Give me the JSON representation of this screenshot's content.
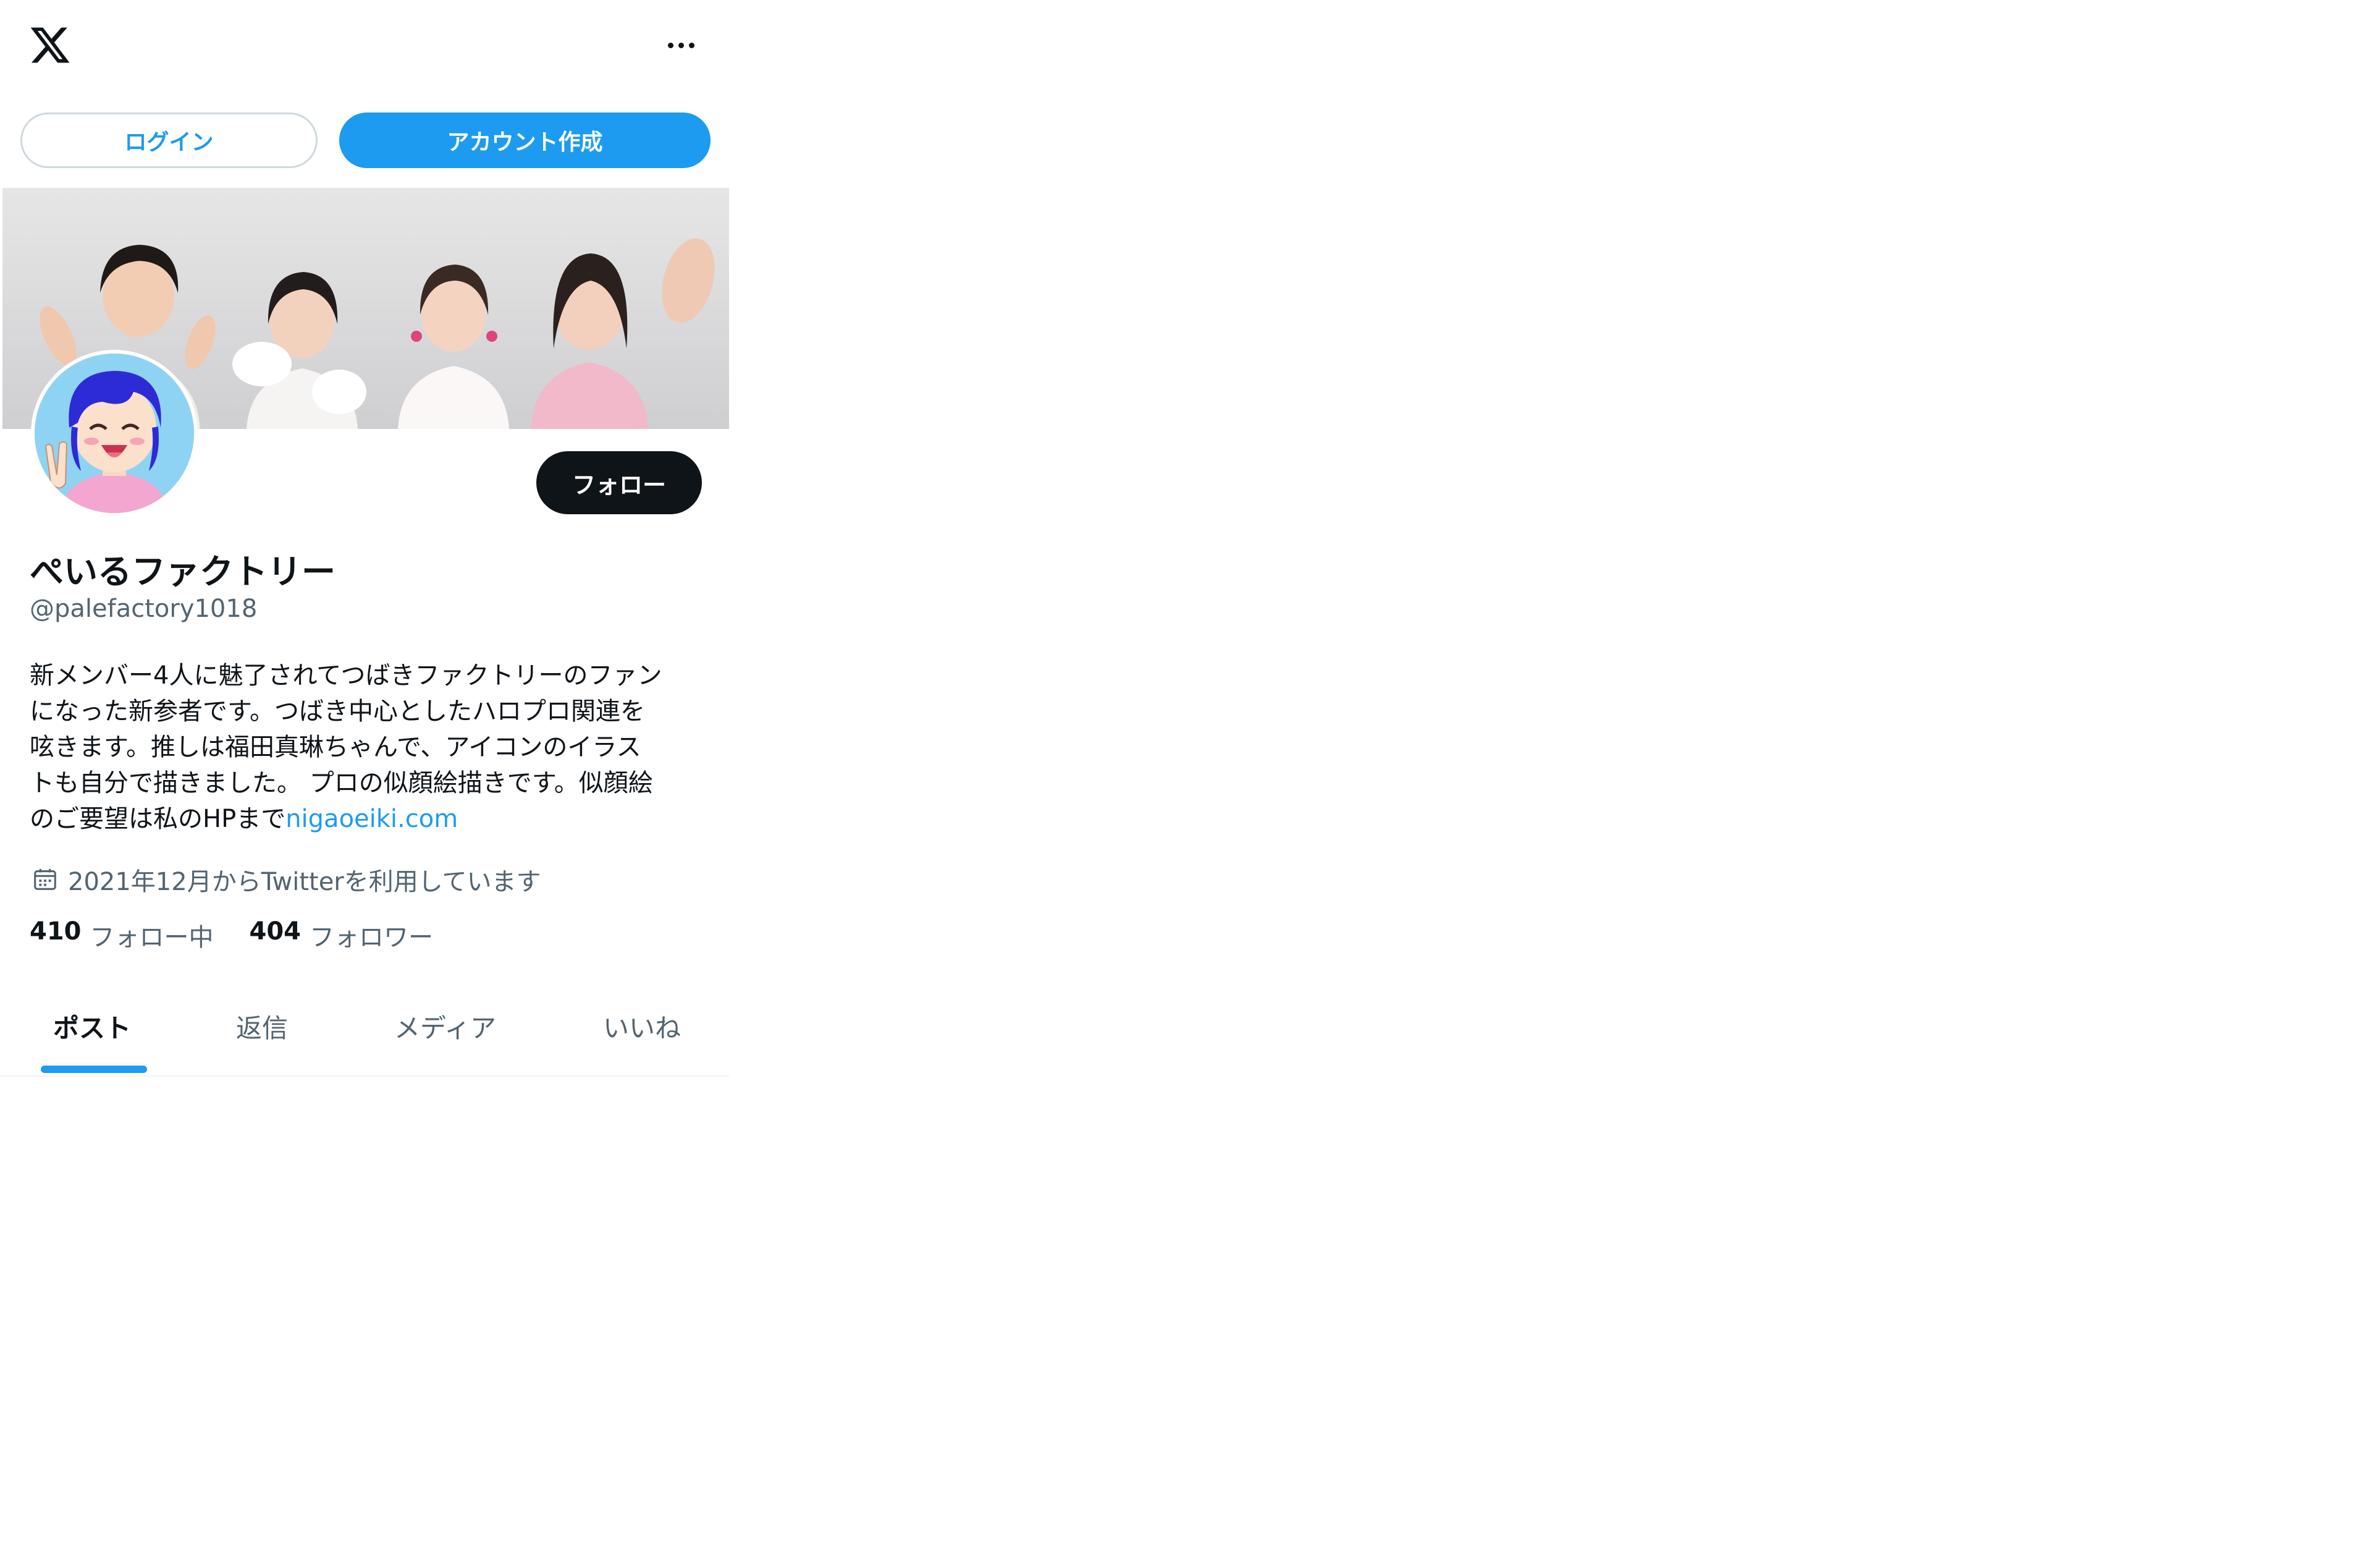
{
  "top_bar": {
    "logo_icon": "x-logo-icon",
    "more_icon": "more-horizontal-icon"
  },
  "auth": {
    "login_label": "ログイン",
    "signup_label": "アカウント作成"
  },
  "profile": {
    "follow_label": "フォロー",
    "display_name": "ぺいるファクトリー",
    "handle": "@palefactory1018",
    "bio_lines": [
      "新メンバー4人に魅了されてつばきファクトリーのファン",
      "になった新参者です。つばき中心としたハロプロ関連を",
      "呟きます。推しは福田真琳ちゃんで、アイコンのイラス",
      "トも自分で描きました。 プロの似顔絵描きです。似顔絵",
      "のご要望は私のHPまで"
    ],
    "bio_link": "nigaoeiki.com",
    "joined": "2021年12月からTwitterを利用しています",
    "following_count": "410",
    "following_label": "フォロー中",
    "followers_count": "404",
    "followers_label": "フォロワー"
  },
  "tabs": [
    {
      "label": "ポスト",
      "active": true
    },
    {
      "label": "返信",
      "active": false
    },
    {
      "label": "メディア",
      "active": false
    },
    {
      "label": "いいね",
      "active": false
    }
  ],
  "colors": {
    "accent": "#1d9bf0",
    "text_primary": "#0f1419",
    "text_secondary": "#536471",
    "border": "#cfd9de"
  }
}
